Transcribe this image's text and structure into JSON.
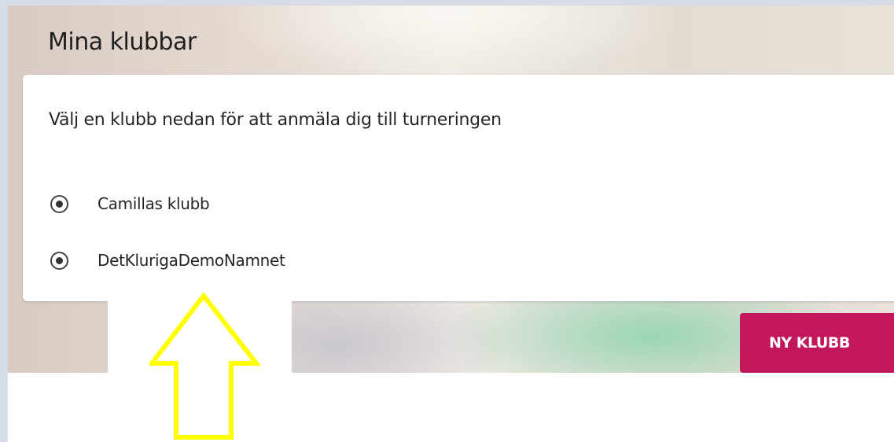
{
  "header": {
    "title": "Mina klubbar"
  },
  "card": {
    "instruction": "Välj en klubb nedan för att anmäla dig till turneringen",
    "clubs": [
      {
        "label": "Camillas klubb"
      },
      {
        "label": "DetKlurigaDemoNamnet"
      }
    ]
  },
  "actions": {
    "new_club_label": "NY KLUBB"
  },
  "colors": {
    "accent": "#c2185b",
    "annotation_arrow": "#ffff00"
  },
  "annotation": {
    "icon": "arrow-up-icon"
  }
}
